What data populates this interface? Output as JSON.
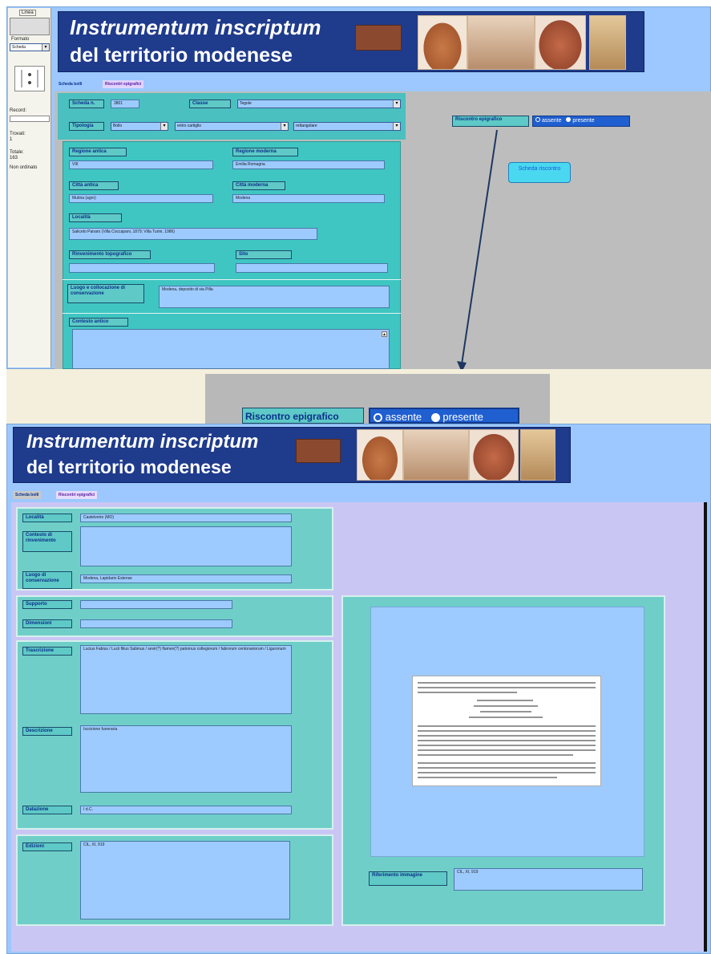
{
  "top_window": {
    "sidebar": {
      "line_label": "Linea",
      "format_label": "Formato",
      "format_value": "Scheda",
      "records_label": "Record:",
      "found_label": "Trovati:",
      "found_value": "1",
      "total_label": "Totale:",
      "total_value": "163",
      "not_filtered": "Non ordinato"
    },
    "banner": {
      "title_line1": "Instrumentum inscriptum",
      "title_line2": "del territorio modenese"
    },
    "tabs": [
      "Scheda bolli",
      "Riscontri epigrafici"
    ],
    "form": {
      "scheda_label": "Scheda n.",
      "scheda_value": "3801",
      "classe_label": "Classe",
      "classe_value": "Tegole",
      "tipologia_label": "Tipologia",
      "tipologia_values": [
        "Bollo",
        "entro cartiglio",
        "rettangolare"
      ],
      "regione_antica_label": "Regione antica",
      "regione_antica_value": "VIII",
      "regione_moderna_label": "Regione moderna",
      "regione_moderna_value": "Emilia Romagna",
      "citta_antica_label": "Città antica",
      "citta_antica_value": "Mutina (agro)",
      "citta_moderna_label": "Città moderna",
      "citta_moderna_value": "Modena",
      "localita_label": "Località",
      "localita_value": "Saliceto Panaro (Villa Coccapani, 1879; Villa Turini, 1986)",
      "rinvenimento_label": "Rinvenimento topografico",
      "sito_label": "Sito",
      "luogo_label": "Luogo e collocazione di conservazione",
      "luogo_value": "Modena, deposito di via Pilla",
      "contesto_label": "Contesto antico"
    },
    "riscontro": {
      "label": "Riscontro epigrafico",
      "option_absent": "assente",
      "option_present": "presente"
    },
    "scheda_button": "Scheda riscontro"
  },
  "zoom_strip": {
    "label": "Riscontro epigrafico",
    "option_absent": "assente",
    "option_present": "presente"
  },
  "bottom_window": {
    "banner": {
      "title_line1": "Instrumentum inscriptum",
      "title_line2": "del territorio modenese"
    },
    "tabs": [
      "Scheda bolli",
      "Riscontri epigrafici"
    ],
    "fields": {
      "localita_label": "Località",
      "localita_value": "Castelvetro (MO)",
      "contesto_label": "Contesto di rinvenimento",
      "luogo_label": "Luogo di conservazione",
      "luogo_value": "Modena, Lapidario Estense",
      "supporto_label": "Supporto",
      "dimensioni_label": "Dimensioni",
      "trascrizione_label": "Trascrizione",
      "trascrizione_value": "Lucius Fabius / Lucii filius Sabinus / sevir(?) flamen(?) patronus collegiorum / fabrorum centonariorum / Liguronum",
      "descrizione_label": "Descrizione",
      "descrizione_value": "Iscrizione funeraria",
      "datazione_label": "Datazione",
      "datazione_value": "I d.C.",
      "edizioni_label": "Edizioni",
      "edizioni_value": "CIL, XI, 919",
      "bibliografia_label": "Riferimento immagine",
      "bibliografia_value": "CIL, XI, 919"
    }
  }
}
